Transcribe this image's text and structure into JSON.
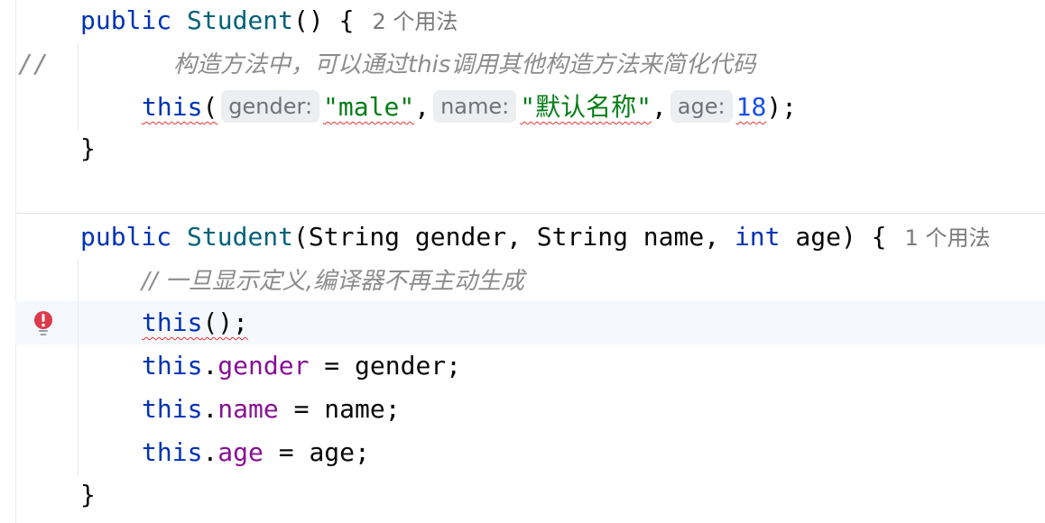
{
  "editor": {
    "gutter_comment": "//",
    "constructor1": {
      "modifier": "public",
      "name": "Student",
      "params": "()",
      "brace": "{",
      "usages": "2 个用法",
      "comment": "构造方法中，可以通过this调用其他构造方法来简化代码",
      "call": {
        "keyword": "this",
        "open": "(",
        "hint_gender": "gender:",
        "arg_gender": "\"male\"",
        "hint_name": "name:",
        "arg_name": "\"默认名称\"",
        "hint_age": "age:",
        "arg_age": "18",
        "close": ");"
      },
      "close_brace": "}"
    },
    "constructor2": {
      "modifier": "public",
      "name": "Student",
      "open_paren": "(",
      "type1": "String",
      "param1": "gender",
      "type2": "String",
      "param2": "name",
      "type3": "int",
      "param3": "age",
      "close": ") {",
      "usages": "1 个用法",
      "comment": "// 一旦显示定义,编译器不再主动生成",
      "this_call": "this",
      "this_call_rest": "();",
      "assign1": {
        "kw": "this",
        "field": "gender",
        "rest": " = gender;"
      },
      "assign2": {
        "kw": "this",
        "field": "name",
        "rest": " = name;"
      },
      "assign3": {
        "kw": "this",
        "field": "age",
        "rest": " = age;"
      },
      "close_brace": "}"
    },
    "error_icon": "error-bulb-icon",
    "colors": {
      "keyword": "#0033b3",
      "method": "#00627a",
      "string": "#067d17",
      "number": "#1750eb",
      "field": "#871094",
      "comment": "#8c8c8c",
      "error": "#e53333"
    }
  }
}
